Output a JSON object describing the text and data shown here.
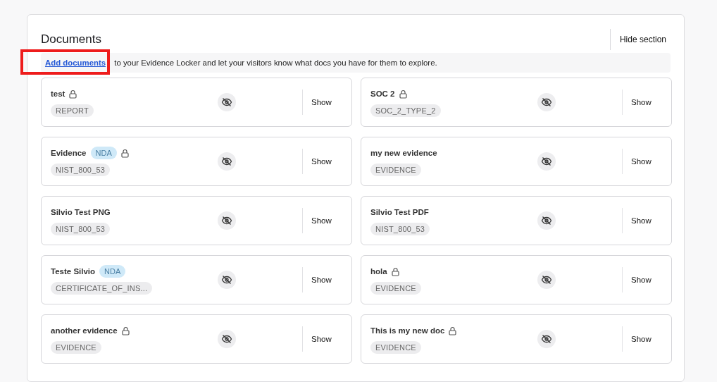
{
  "section": {
    "title": "Documents",
    "hide_button": "Hide section"
  },
  "banner": {
    "link": "Add documents",
    "text": " to your Evidence Locker and let your visitors know what docs you have for them to explore.",
    "highlighted": true
  },
  "documents": [
    {
      "title": "test",
      "locked": true,
      "nda": false,
      "tag": "REPORT",
      "action": "Show"
    },
    {
      "title": "SOC 2",
      "locked": true,
      "nda": false,
      "tag": "SOC_2_TYPE_2",
      "action": "Show"
    },
    {
      "title": "Evidence",
      "locked": true,
      "nda": true,
      "nda_label": "NDA",
      "tag": "NIST_800_53",
      "action": "Show"
    },
    {
      "title": "my new evidence",
      "locked": false,
      "nda": false,
      "tag": "EVIDENCE",
      "action": "Show"
    },
    {
      "title": "Silvio Test PNG",
      "locked": false,
      "nda": false,
      "tag": "NIST_800_53",
      "action": "Show"
    },
    {
      "title": "Silvio Test PDF",
      "locked": false,
      "nda": false,
      "tag": "NIST_800_53",
      "action": "Show"
    },
    {
      "title": "Teste Silvio",
      "locked": false,
      "nda": true,
      "nda_label": "NDA",
      "tag": "CERTIFICATE_OF_INS...",
      "action": "Show"
    },
    {
      "title": "hola",
      "locked": true,
      "nda": false,
      "tag": "EVIDENCE",
      "action": "Show"
    },
    {
      "title": "another evidence",
      "locked": true,
      "nda": false,
      "tag": "EVIDENCE",
      "action": "Show"
    },
    {
      "title": "This is my new doc",
      "locked": true,
      "nda": false,
      "tag": "EVIDENCE",
      "action": "Show"
    }
  ]
}
